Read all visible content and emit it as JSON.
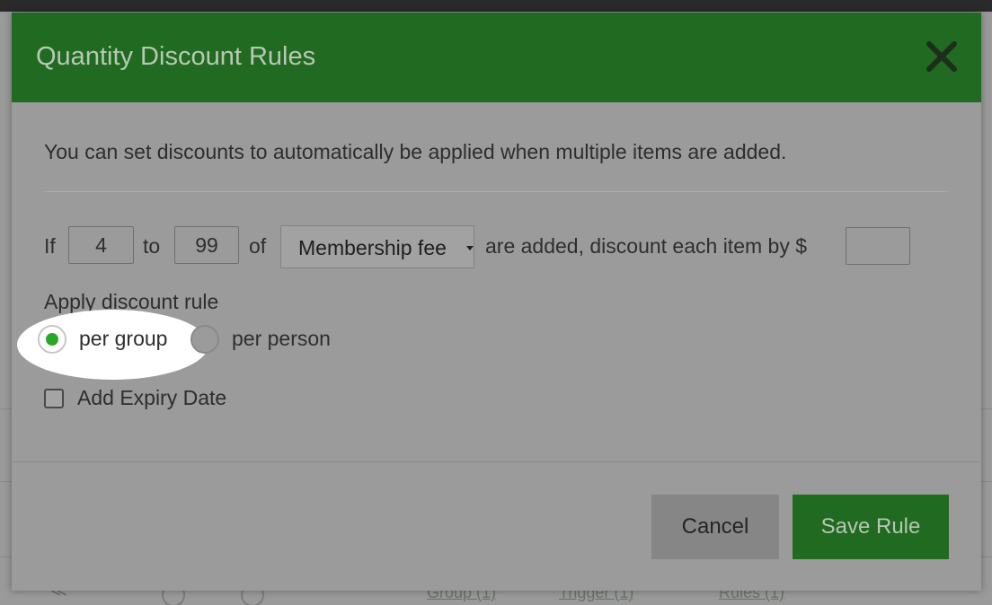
{
  "background": {
    "links": [
      "Group (1)",
      "Trigger (1)",
      "Rules (1)"
    ]
  },
  "modal": {
    "title": "Quantity Discount Rules",
    "close_icon": "close-x-icon",
    "intro": "You can set discounts to automatically be applied when multiple items are added.",
    "rule": {
      "if_label": "If",
      "from_value": "4",
      "to_label": "to",
      "to_value": "99",
      "of_label": "of",
      "item_select": "Membership fee",
      "suffix": "are added, discount each item by $",
      "discount_value": ""
    },
    "apply": {
      "label": "Apply discount rule",
      "options": [
        {
          "label": "per group",
          "selected": true
        },
        {
          "label": "per person",
          "selected": false
        }
      ]
    },
    "expiry": {
      "label": "Add Expiry Date",
      "checked": false
    },
    "buttons": {
      "cancel": "Cancel",
      "save": "Save Rule"
    }
  },
  "colors": {
    "header_green": "#216a21",
    "radio_selected": "#27a827",
    "overlay_gray": "#9b9b9b"
  }
}
